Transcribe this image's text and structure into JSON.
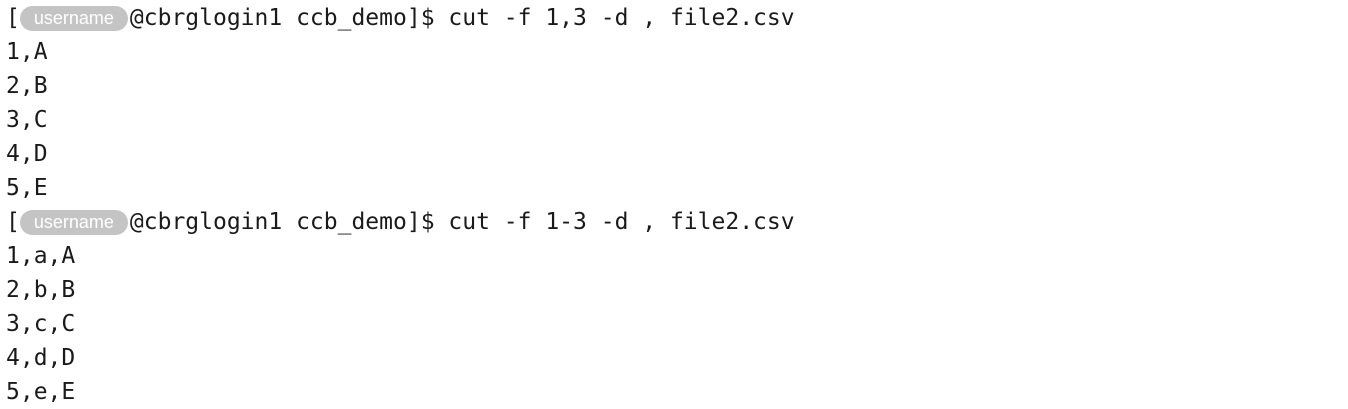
{
  "terminal": {
    "blocks": [
      {
        "prompt_open": "[",
        "username_badge": "username",
        "host_path": "@cbrglogin1 ccb_demo]$ ",
        "command": "cut -f 1,3 -d , file2.csv",
        "output": [
          "1,A",
          "2,B",
          "3,C",
          "4,D",
          "5,E"
        ]
      },
      {
        "prompt_open": "[",
        "username_badge": "username",
        "host_path": "@cbrglogin1 ccb_demo]$ ",
        "command": "cut -f 1-3 -d , file2.csv",
        "output": [
          "1,a,A",
          "2,b,B",
          "3,c,C",
          "4,d,D",
          "5,e,E"
        ]
      }
    ]
  }
}
